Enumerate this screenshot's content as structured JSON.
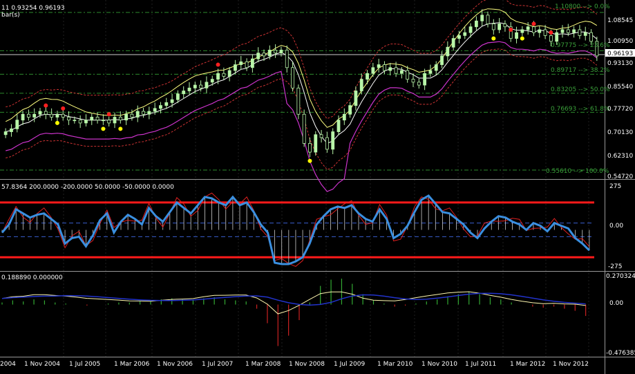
{
  "header": {
    "title_line1": "11 0.93254 0.96193",
    "title_line2": "bar(s)"
  },
  "colors": {
    "background": "#000000",
    "grid": "#1f1f1f",
    "candle": "#b8f5a8",
    "bollinger_mid": "#ffffff",
    "bollinger_outer": "#ffff80",
    "lower_band": "#cc33cc",
    "envelope": "#cc3333",
    "fib": "#2e8b2e",
    "fib_text": "#3aa03a",
    "cci_main": "#3a8fe0",
    "cci_signal": "#e02020",
    "cci_level": "#ff1a1a",
    "cci_zero": "#3a5fcf",
    "macd_line": "#fff8b0",
    "macd_signal": "#2233cc",
    "hist_pos": "#33aa33",
    "hist_neg": "#cc2222",
    "axis_text": "#ffffff",
    "fractal_up": "#ff2020",
    "fractal_down": "#ffff00"
  },
  "price_axis": {
    "labels": [
      "1.08545",
      "1.00950",
      "0.93130",
      "0.85540",
      "0.77720",
      "0.70130",
      "0.62310",
      "0.54720"
    ],
    "current_price": "0.96193"
  },
  "fib_labels": {
    "l0": "1.10800 --> 0.0%",
    "l236": "0.97775 --> 23.6%",
    "l382": "0.89717 --> 38.2%",
    "l50": "0.83205 --> 50.0%",
    "l618": "0.76693 --> 61.8%",
    "l100": "0.55610 --> 100.0%"
  },
  "cci_panel": {
    "header": "57.8364 200.0000 -200.0000 50.0000 -50.0000 0.0000",
    "labels": [
      "275",
      "0.00",
      "-275"
    ]
  },
  "macd_panel": {
    "header": "0.188890 0.000000",
    "labels": [
      "0.270324",
      "0.00",
      "-0.476385"
    ]
  },
  "time_axis": {
    "labels": [
      "2004",
      "1 Nov 2004",
      "1 Jul 2005",
      "1 Mar 2006",
      "1 Nov 2006",
      "1 Jul 2007",
      "1 Mar 2008",
      "1 Nov 2008",
      "1 Jul 2009",
      "1 Mar 2010",
      "1 Nov 2010",
      "1 Jul 2011",
      "1 Mar 2012",
      "1 Nov 2012"
    ]
  },
  "chart_data": [
    {
      "type": "candlestick",
      "price_axis": [
        0.5472,
        1.08545
      ],
      "fib_levels": [
        {
          "price": 1.108,
          "percent": 0.0
        },
        {
          "price": 0.97775,
          "percent": 23.6
        },
        {
          "price": 0.89717,
          "percent": 38.2
        },
        {
          "price": 0.83205,
          "percent": 50.0
        },
        {
          "price": 0.76693,
          "percent": 61.8
        },
        {
          "price": 0.5561,
          "percent": 100.0
        }
      ],
      "last_price": 0.96193,
      "close": [
        0.7,
        0.71,
        0.74,
        0.76,
        0.75,
        0.76,
        0.77,
        0.76,
        0.75,
        0.76,
        0.75,
        0.74,
        0.74,
        0.73,
        0.74,
        0.75,
        0.74,
        0.74,
        0.73,
        0.75,
        0.74,
        0.76,
        0.75,
        0.77,
        0.76,
        0.77,
        0.78,
        0.79,
        0.8,
        0.81,
        0.83,
        0.84,
        0.85,
        0.86,
        0.85,
        0.87,
        0.88,
        0.9,
        0.89,
        0.91,
        0.93,
        0.94,
        0.92,
        0.95,
        0.97,
        0.96,
        0.98,
        0.97,
        0.98,
        0.92,
        0.85,
        0.76,
        0.66,
        0.63,
        0.69,
        0.68,
        0.64,
        0.7,
        0.74,
        0.76,
        0.79,
        0.84,
        0.88,
        0.9,
        0.92,
        0.93,
        0.91,
        0.92,
        0.9,
        0.91,
        0.88,
        0.87,
        0.86,
        0.9,
        0.91,
        0.93,
        0.96,
        0.99,
        1.02,
        1.03,
        1.04,
        1.06,
        1.08,
        1.1,
        1.07,
        1.05,
        1.07,
        1.06,
        1.02,
        1.04,
        1.05,
        1.06,
        1.04,
        1.05,
        1.03,
        1.01,
        1.04,
        1.05,
        1.04,
        1.05,
        1.03,
        1.04,
        1.01,
        0.96
      ]
    },
    {
      "type": "line",
      "name": "CCI",
      "ylim": [
        -275,
        275
      ],
      "levels": [
        200,
        -200,
        50,
        -50,
        0
      ],
      "values": [
        -20,
        40,
        150,
        120,
        90,
        110,
        120,
        80,
        40,
        -100,
        -60,
        -50,
        -120,
        -40,
        70,
        120,
        -20,
        60,
        110,
        80,
        40,
        160,
        100,
        60,
        130,
        200,
        160,
        120,
        180,
        240,
        230,
        200,
        180,
        240,
        180,
        200,
        130,
        40,
        -20,
        -240,
        -250,
        -250,
        -230,
        -200,
        -100,
        40,
        100,
        150,
        170,
        160,
        180,
        120,
        80,
        60,
        150,
        80,
        -60,
        -30,
        30,
        130,
        220,
        250,
        190,
        130,
        120,
        80,
        40,
        -20,
        -60,
        10,
        60,
        100,
        90,
        60,
        40,
        0,
        50,
        30,
        -10,
        50,
        30,
        10,
        -60,
        -100,
        -150
      ]
    },
    {
      "type": "bar",
      "name": "MACD",
      "ylim": [
        -0.476385,
        0.270324
      ],
      "values": [
        0.02,
        0.04,
        0.03,
        0.05,
        0.04,
        0.02,
        0.01,
        0.0,
        -0.01,
        0.0,
        0.01,
        0.02,
        0.02,
        0.03,
        0.03,
        0.05,
        0.06,
        0.05,
        0.04,
        0.06,
        0.07,
        0.05,
        0.04,
        0.03,
        -0.04,
        -0.18,
        -0.4,
        -0.3,
        -0.15,
        0.02,
        0.18,
        0.24,
        0.25,
        0.2,
        0.1,
        0.04,
        0.01,
        -0.02,
        -0.01,
        0.01,
        0.03,
        0.05,
        0.08,
        0.1,
        0.12,
        0.1,
        0.07,
        0.05,
        0.02,
        0.0,
        -0.02,
        -0.03,
        -0.02,
        -0.04,
        -0.06,
        -0.11
      ]
    }
  ]
}
